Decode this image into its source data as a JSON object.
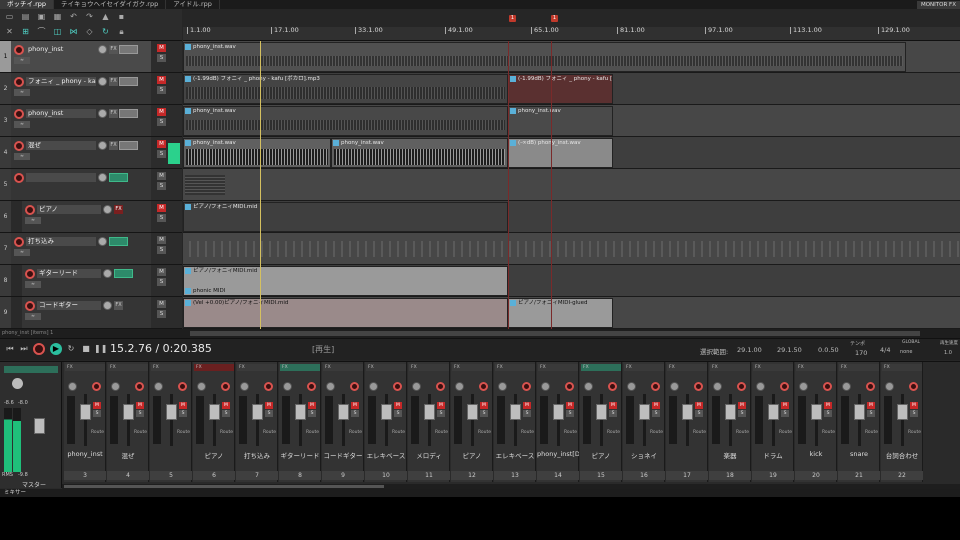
{
  "tabs": [
    {
      "label": "ボッチイ.rpp",
      "active": true
    },
    {
      "label": "テイキョウヘイセイダイガク.rpp",
      "active": false
    },
    {
      "label": "アイドル.rpp",
      "active": false
    }
  ],
  "top_right_badge": "MONITOR FX",
  "ruler": {
    "ticks": [
      "1.1.00",
      "17.1.00",
      "33.1.00",
      "49.1.00",
      "65.1.00",
      "81.1.00",
      "97.1.00",
      "113.1.00",
      "129.1.00"
    ]
  },
  "markers": [
    "1",
    "1"
  ],
  "tracks": [
    {
      "num": "1",
      "name": "phony_inst",
      "selected": true,
      "fx": "FX"
    },
    {
      "num": "2",
      "name": "フォニィ _ phony - kafu [ボ",
      "selected": false,
      "fx": "FX"
    },
    {
      "num": "3",
      "name": "phony_inst",
      "selected": false,
      "fx": "FX"
    },
    {
      "num": "4",
      "name": "混ぜ",
      "selected": false,
      "fx": "FX"
    },
    {
      "num": "5",
      "name": "",
      "selected": false,
      "fx": "FX"
    },
    {
      "num": "6",
      "name": "ピアノ",
      "selected": false,
      "fx": "FX"
    },
    {
      "num": "7",
      "name": "打ち込み",
      "selected": false,
      "fx": "FX"
    },
    {
      "num": "8",
      "name": "ギターリード",
      "selected": false,
      "fx": "FX"
    },
    {
      "num": "9",
      "name": "コードギター",
      "selected": false,
      "fx": "FX"
    }
  ],
  "items": {
    "i1": "phony_inst.wav",
    "i2": "(-1.99dB) フォニィ _ phony - kafu [ボカロ].mp3",
    "i2b": "(-1.99dB) フォニィ _ phony - kafu [ボカロ].mp3",
    "i3": "phony_inst.wav",
    "i3b": "phony_inst.wav",
    "i4a": "phony_inst.wav",
    "i4b": "phony_inst.wav",
    "i4c": "(-∞dB) phony_inst.wav",
    "i6": "ピアノ/フォニィMIDI.mid",
    "i8": "ピアノ/フォニィMIDI.mid",
    "i8b": "phonic MIDI",
    "i9": "(Vel +0.00)ピアノ/フォニィMIDI.mid",
    "i9b": "ピアノ/フォニィMIDI-glued"
  },
  "track_footer": "phony_inst [items] 1",
  "transport": {
    "time": "15.2.76 / 0:20.385",
    "status": "[再生]",
    "sel_label": "選択範囲:",
    "sel_start": "29.1.00",
    "sel_end": "29.1.50",
    "sel_len": "0.0.50",
    "tempo_label": "テンポ",
    "tempo": "170",
    "sig": "4/4",
    "global_label": "GLOBAL",
    "global_val": "none",
    "rate_label": "再生速度",
    "rate": "1.0"
  },
  "mixer": {
    "master": {
      "label": "マスター",
      "db_left": "-8.6",
      "db_right": "-8.0",
      "rms_label": "RMS",
      "rms_val": "-9.8"
    },
    "strips": [
      {
        "name": "phony_inst",
        "num": "3",
        "top": "FX",
        "color": "plain"
      },
      {
        "name": "混ぜ",
        "num": "4",
        "top": "FX",
        "color": "plain"
      },
      {
        "name": "",
        "num": "5",
        "top": "FX",
        "color": "plain"
      },
      {
        "name": "ピアノ",
        "num": "6",
        "top": "FX",
        "color": "red"
      },
      {
        "name": "打ち込み",
        "num": "7",
        "top": "FX",
        "color": "plain"
      },
      {
        "name": "ギターリード",
        "num": "8",
        "top": "FX",
        "color": "green"
      },
      {
        "name": "コードギター",
        "num": "9",
        "top": "FX",
        "color": "plain"
      },
      {
        "name": "エレキベース",
        "num": "10",
        "top": "FX",
        "color": "plain"
      },
      {
        "name": "メロディ",
        "num": "11",
        "top": "FX",
        "color": "plain"
      },
      {
        "name": "ピアノ",
        "num": "12",
        "top": "FX",
        "color": "plain"
      },
      {
        "name": "エレキベース",
        "num": "13",
        "top": "FX",
        "color": "plain"
      },
      {
        "name": "phony_inst[DF",
        "num": "14",
        "top": "FX",
        "color": "plain"
      },
      {
        "name": "ピアノ",
        "num": "15",
        "top": "FX",
        "color": "green"
      },
      {
        "name": "ショネイ",
        "num": "16",
        "top": "FX",
        "color": "plain"
      },
      {
        "name": "",
        "num": "17",
        "top": "FX",
        "color": "plain"
      },
      {
        "name": "楽器",
        "num": "18",
        "top": "FX",
        "color": "plain"
      },
      {
        "name": "ドラム",
        "num": "19",
        "top": "FX",
        "color": "plain"
      },
      {
        "name": "kick",
        "num": "20",
        "top": "FX",
        "color": "plain"
      },
      {
        "name": "snare",
        "num": "21",
        "top": "FX",
        "color": "plain"
      },
      {
        "name": "台詞合わせ",
        "num": "22",
        "top": "FX",
        "color": "plain"
      },
      {
        "name": "後藤ひとり",
        "num": "23",
        "top": "FX",
        "color": "plain"
      }
    ],
    "route_label": "Route",
    "bottom_tab": "ミキサー"
  },
  "colors": {
    "accent": "#2bbf9f",
    "record": "#d9534f",
    "mute": "#c62828"
  }
}
